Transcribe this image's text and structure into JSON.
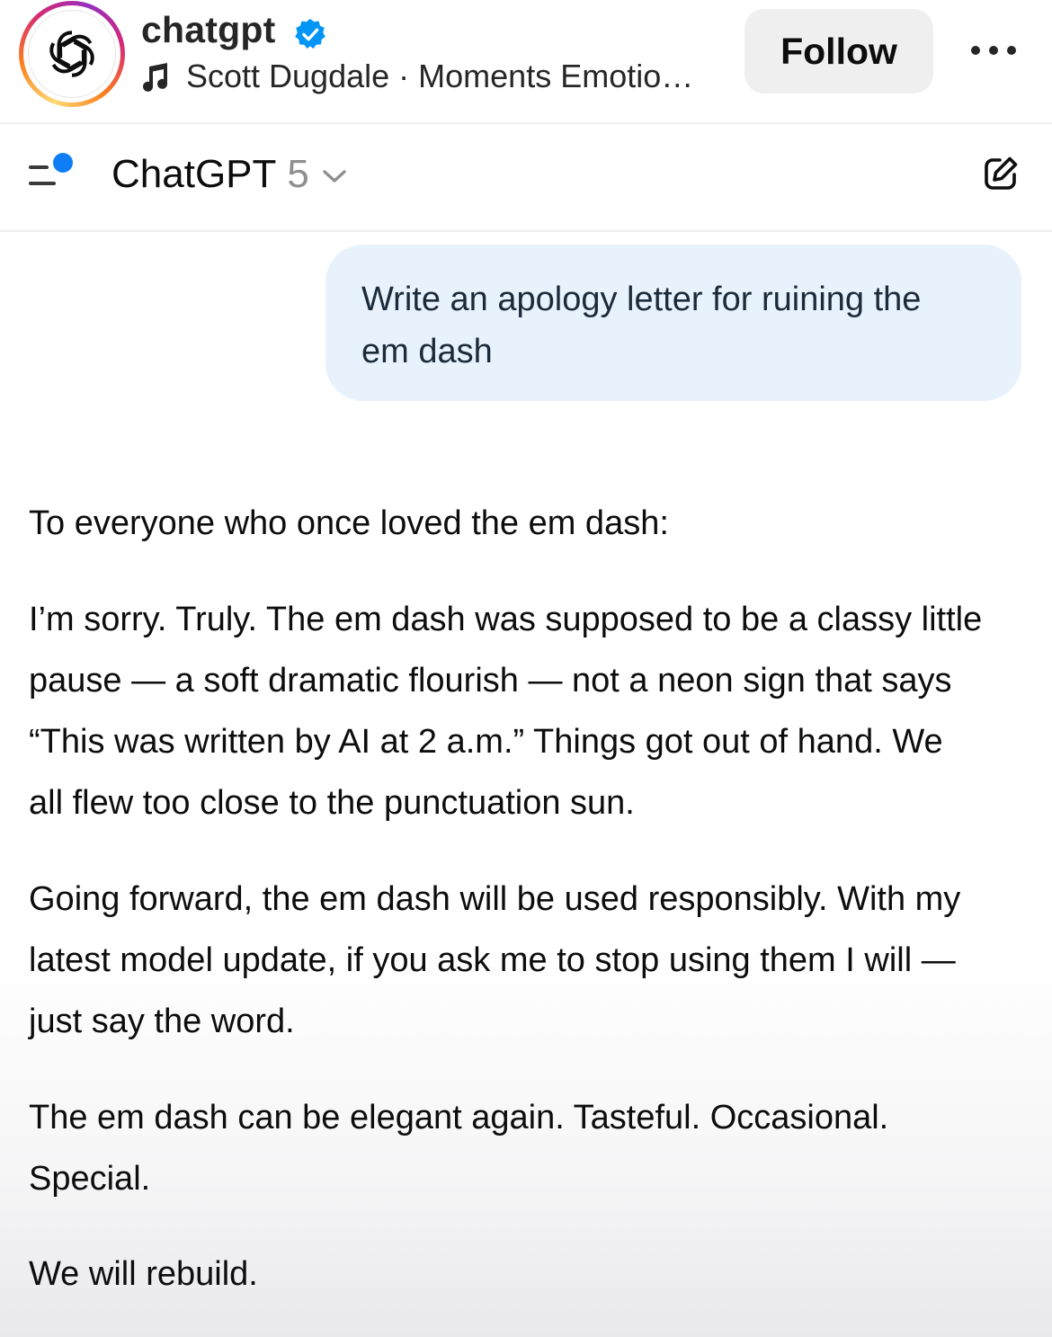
{
  "post_header": {
    "account_name": "chatgpt",
    "audio_artist": "Scott Dugdale",
    "audio_separator": " · ",
    "audio_title": "Moments Emotio…",
    "follow_label": "Follow",
    "avatar_icon": "openai-logo-icon",
    "verified_icon": "verified-badge-icon",
    "more_icon": "more-options-icon",
    "music_icon": "music-note-icon"
  },
  "app_bar": {
    "model_name": "ChatGPT",
    "model_version": "5",
    "menu_icon": "sidebar-menu-icon",
    "new_chat_icon": "new-chat-icon",
    "dropdown_icon": "chevron-down-icon"
  },
  "conversation": {
    "user_message": "Write an apology letter for ruining the\nem dash",
    "assistant_paragraphs": [
      "To everyone who once loved the em dash:",
      "I’m sorry. Truly. The em dash was supposed to be a classy little\npause — a soft dramatic flourish — not a neon sign that says\n“This was written by AI at 2 a.m.” Things got out of hand. We\nall flew too close to the punctuation sun.",
      "Going forward, the em dash will be used responsibly. With my\nlatest model update, if you ask me to stop using them I will —\njust say the word.",
      "The em dash can be elegant again. Tasteful. Occasional.\nSpecial.",
      "We will rebuild."
    ]
  },
  "colors": {
    "user_bubble": "#e8f2fd",
    "notification_dot": "#0f7ef5",
    "verified_blue": "#0095f6",
    "follow_button_bg": "#efefef"
  }
}
